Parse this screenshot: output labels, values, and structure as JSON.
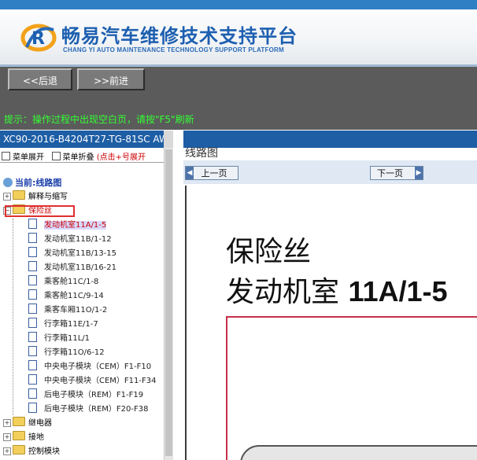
{
  "header": {
    "title": "畅易汽车维修技术支持平台",
    "subtitle": "CHANG YI AUTO MAINTENANCE TECHNOLOGY SUPPORT PLATFORM",
    "logo_icon": "r-swoosh-logo"
  },
  "nav": {
    "back_label": "<<后退",
    "forward_label": ">>前进"
  },
  "notice": {
    "text": "提示：操作过程中出现空白页，请按\"F5\"刷新"
  },
  "left": {
    "vehicle": "XC90-2016-B4204T27-TG-81SC AW",
    "expand_label": "菜单展开",
    "collapse_label": "菜单折叠",
    "collapse_hint": "(点击+号展开",
    "tree_root": "当前:线路图",
    "folders_top": [
      {
        "label": "解释与缩写",
        "expanded": false
      },
      {
        "label": "保险丝",
        "expanded": true
      }
    ],
    "docs": [
      {
        "label": "发动机室11A/1-5",
        "selected": true
      },
      {
        "label": "发动机室11B/1-12"
      },
      {
        "label": "发动机室11B/13-15"
      },
      {
        "label": "发动机室11B/16-21"
      },
      {
        "label": "乘客舱11C/1-8"
      },
      {
        "label": "乘客舱11C/9-14"
      },
      {
        "label": "乘客车厢11O/1-2"
      },
      {
        "label": "行李箱11E/1-7"
      },
      {
        "label": "行李箱11L/1"
      },
      {
        "label": "行李箱11O/6-12"
      },
      {
        "label": "中央电子模块（CEM）F1-F10"
      },
      {
        "label": "中央电子模块（CEM）F11-F34"
      },
      {
        "label": "后电子模块（REM）F1-F19"
      },
      {
        "label": "后电子模块（REM）F20-F38"
      }
    ],
    "folders_bottom": [
      {
        "label": "继电器"
      },
      {
        "label": "接地"
      },
      {
        "label": "控制模块"
      }
    ]
  },
  "right": {
    "title": "线路图",
    "prev_label": "上一页",
    "next_label": "下一页",
    "doc_line1": "保险丝",
    "doc_line2_cn": "发动机室",
    "doc_line2_code": "11A/1-5"
  },
  "colors": {
    "accent": "#1e5ea5",
    "notice": "#33ff33",
    "highlight": "#e03030"
  }
}
